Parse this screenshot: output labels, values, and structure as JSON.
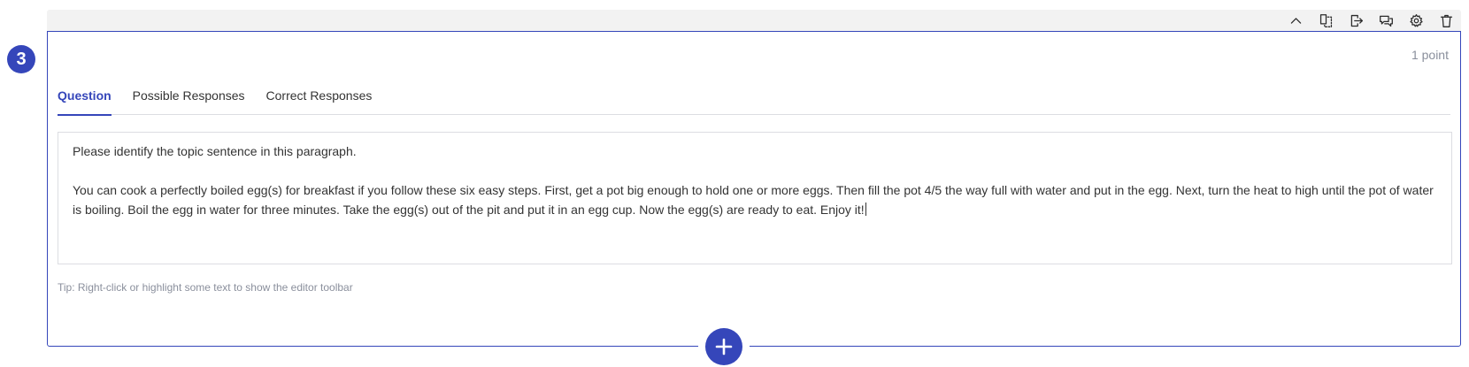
{
  "question_number": "3",
  "points_label": "1 point",
  "toolbar": {
    "icons": [
      "chevron-up-icon",
      "duplicate-icon",
      "move-icon",
      "comment-icon",
      "gear-icon",
      "trash-icon"
    ]
  },
  "tabs": [
    {
      "label": "Question",
      "active": true
    },
    {
      "label": "Possible Responses",
      "active": false
    },
    {
      "label": "Correct Responses",
      "active": false
    }
  ],
  "editor": {
    "prompt": "Please identify the topic sentence in this paragraph.",
    "paragraph": "You can cook a perfectly boiled egg(s) for breakfast if you follow these six easy steps. First, get a pot big enough to hold one or more eggs. Then fill the pot 4/5 the way full with water and put in the egg. Next, turn the heat to high until the pot of water is boiling. Boil the egg in water for three minutes. Take the egg(s) out of the pit and put it in an egg cup. Now the egg(s) are ready to eat. Enjoy it!"
  },
  "tip": "Tip: Right-click or highlight some text to show the editor toolbar",
  "colors": {
    "accent": "#3546ba",
    "muted_text": "#8a8f9c",
    "border": "#dcdde2"
  }
}
